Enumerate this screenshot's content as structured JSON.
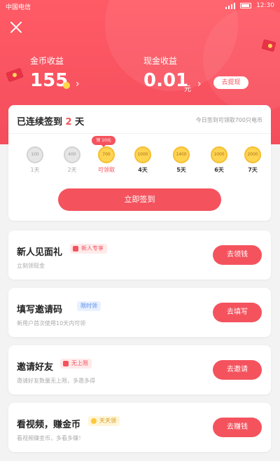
{
  "status_bar": {
    "carrier": "中国电信",
    "time": "12:30"
  },
  "header": {
    "coin_earnings": {
      "label": "金币收益",
      "value": "155"
    },
    "cash_earnings": {
      "label": "现金收益",
      "value": "0.01",
      "unit": "元"
    },
    "withdraw_label": "去提现"
  },
  "signin": {
    "title_prefix": "已连续签到",
    "days": "2",
    "title_suffix": "天",
    "note": "今日签到可领取700只电币",
    "bubble": "领 10元",
    "days_list": [
      {
        "coin": "100",
        "label": "1天"
      },
      {
        "coin": "400",
        "label": "2天"
      },
      {
        "coin": "700",
        "label": "可领取"
      },
      {
        "coin": "1000",
        "label": "4天"
      },
      {
        "coin": "1400",
        "label": "5天"
      },
      {
        "coin": "1000",
        "label": "6天"
      },
      {
        "coin": "2000",
        "label": "7天"
      }
    ],
    "button_label": "立即签到"
  },
  "tasks": [
    {
      "title": "新人见面礼",
      "tag": "新人专享",
      "subtitle": "立刻领现金",
      "button": "去领钱"
    },
    {
      "title": "填写邀请码",
      "tag": "限时领",
      "subtitle": "新用户首次使用10天内可领",
      "button": "去填写"
    },
    {
      "title": "邀请好友",
      "tag": "无上限",
      "subtitle": "邀请好友数量无上限，多邀多得",
      "button": "去邀请"
    },
    {
      "title": "看视频，赚金币",
      "tag": "天天领",
      "subtitle": "看视频赚金币，多看多赚！",
      "button": "去赚钱"
    }
  ],
  "colors": {
    "accent": "#f4535e",
    "gold": "#ffd451",
    "background": "#f3f3f3"
  }
}
